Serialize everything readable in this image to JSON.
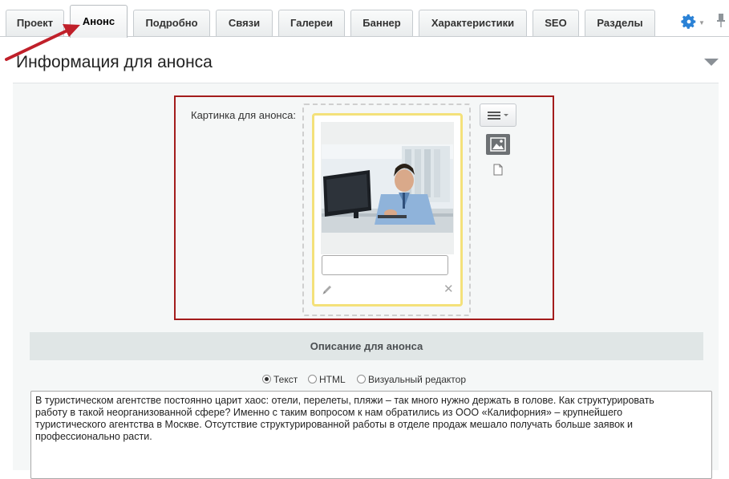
{
  "tabs": [
    {
      "label": "Проект",
      "active": false
    },
    {
      "label": "Анонс",
      "active": true
    },
    {
      "label": "Подробно",
      "active": false
    },
    {
      "label": "Связи",
      "active": false
    },
    {
      "label": "Галереи",
      "active": false
    },
    {
      "label": "Баннер",
      "active": false
    },
    {
      "label": "Характеристики",
      "active": false
    },
    {
      "label": "SEO",
      "active": false
    },
    {
      "label": "Разделы",
      "active": false
    }
  ],
  "toolbar": {
    "settings_icon": "gear-icon",
    "pin_icon": "pin-icon"
  },
  "section": {
    "title": "Информация для анонса"
  },
  "image_field": {
    "label": "Картинка для анонса:",
    "description_value": "",
    "edit_icon": "pencil-icon",
    "delete_icon": "close-icon",
    "menu_icon": "hamburger-menu-icon",
    "picture_icon": "picture-icon",
    "file_icon": "file-icon"
  },
  "description": {
    "title": "Описание для анонса",
    "modes": [
      {
        "label": "Текст",
        "selected": true
      },
      {
        "label": "HTML",
        "selected": false
      },
      {
        "label": "Визуальный редактор",
        "selected": false
      }
    ],
    "text": "В туристическом агентстве постоянно царит хаос: отели, перелеты, пляжи – так много нужно держать в голове. Как структурировать работу в такой неорганизованной сфере? Именно с таким вопросом к нам обратились из ООО «Калифорния» – крупнейшего туристического агентства в Москве. Отсутствие структурированной работы в отделе продаж мешало получать больше заявок и профессионально расти."
  },
  "colors": {
    "highlight_border": "#a31c1c",
    "card_border": "#f4e17a",
    "arrow": "#c0202a"
  }
}
